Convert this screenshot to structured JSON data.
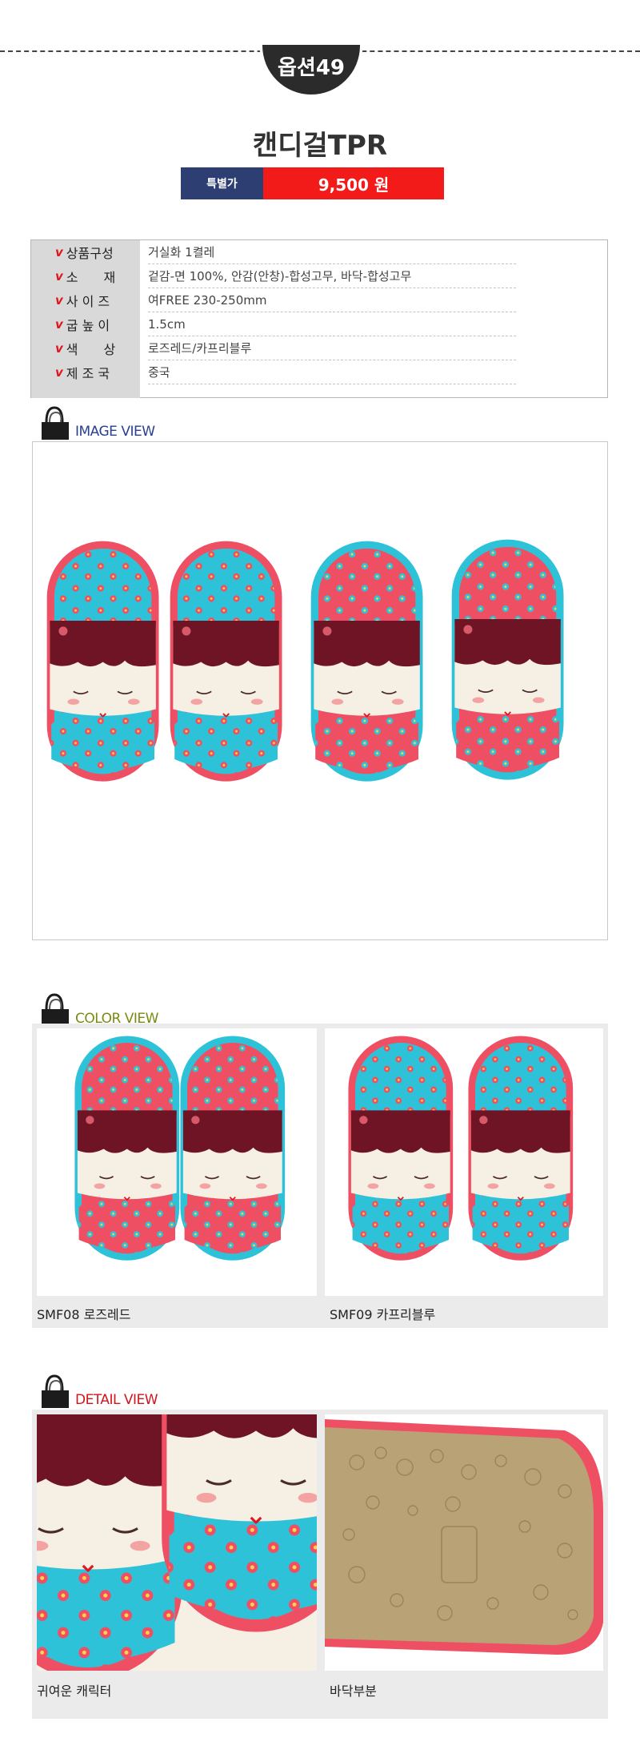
{
  "header": {
    "option_badge": "옵션49",
    "product_title": "캔디걸TPR",
    "price_label": "특별가",
    "price_value": "9,500 원"
  },
  "specs": [
    {
      "label": "상품구성",
      "value": "거실화 1켤레"
    },
    {
      "label": "소　　재",
      "value": "겉감-면 100%, 안감(안창)-합성고무, 바닥-합성고무"
    },
    {
      "label": "사 이 즈",
      "value": "여FREE 230-250mm"
    },
    {
      "label": "굽 높 이",
      "value": "1.5cm"
    },
    {
      "label": "색　　상",
      "value": "로즈레드/카프리블루"
    },
    {
      "label": "제 조 국",
      "value": "중국"
    }
  ],
  "check_mark": "v",
  "sections": {
    "image_view": {
      "title": "IMAGE VIEW",
      "color": "#2a3f8f"
    },
    "color_view": {
      "title": "COLOR VIEW",
      "color": "#7a8a12",
      "items": [
        {
          "caption": "SMF08 로즈레드"
        },
        {
          "caption": "SMF09 카프리블루"
        }
      ]
    },
    "detail_view": {
      "title": "DETAIL VIEW",
      "color": "#d0151b",
      "items": [
        {
          "caption": "귀여운 캐릭터"
        },
        {
          "caption": "바닥부분"
        }
      ]
    }
  },
  "colors": {
    "rose": "#ef4f63",
    "sky": "#2ec2d9",
    "maroon": "#6e1424",
    "cream": "#f6efe4",
    "navy": "#2d3f72",
    "red": "#f31a1a"
  }
}
